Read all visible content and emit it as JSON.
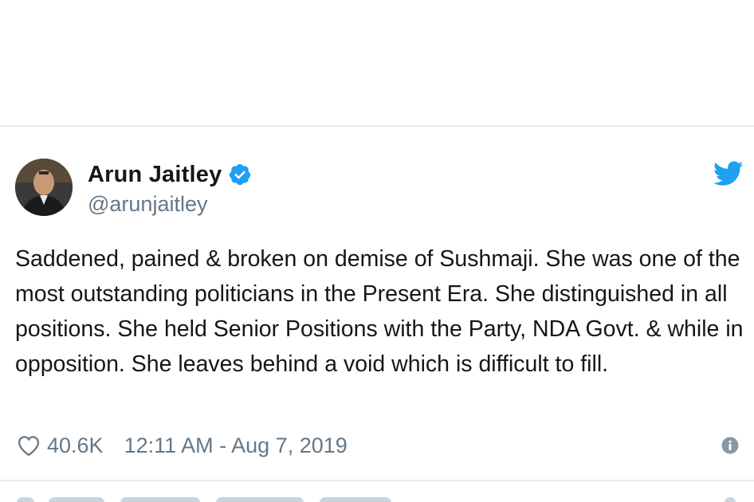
{
  "tweet": {
    "author": {
      "display_name": "Arun Jaitley",
      "handle": "@arunjaitley",
      "verified": true
    },
    "text": "Saddened, pained & broken on demise of Sushmaji. She was one of the most outstanding politicians in the Present Era. She distinguished in all positions. She held Senior Positions with the Party, NDA Govt. & while in opposition. She leaves behind a void which is difficult to fill.",
    "likes": "40.6K",
    "timestamp": "12:11 AM - Aug 7, 2019"
  },
  "colors": {
    "twitter_blue": "#1da1f2",
    "text_primary": "#14171a",
    "text_secondary": "#657786",
    "divider": "#e6ecf0"
  },
  "icons": {
    "verified": "verified-badge-icon",
    "brand": "twitter-bird-icon",
    "like": "heart-icon",
    "info": "info-icon"
  }
}
